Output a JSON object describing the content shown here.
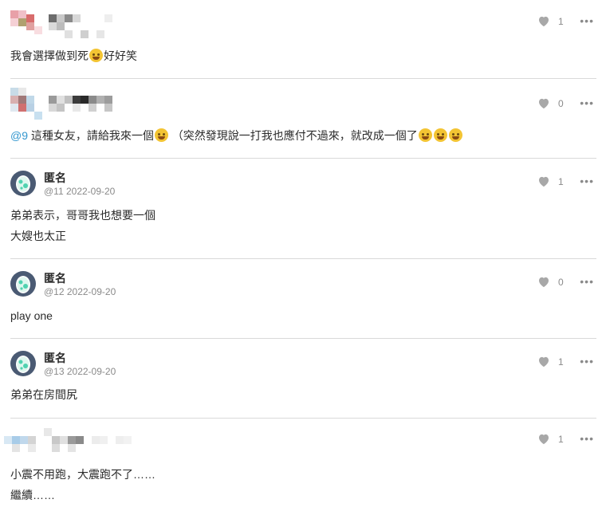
{
  "comments": [
    {
      "id": "c1",
      "author": "",
      "meta": "",
      "likes": "1",
      "lines": [
        "我會選擇做到死",
        "好好笑"
      ]
    },
    {
      "id": "c2",
      "author": "",
      "meta": "",
      "likes": "0",
      "mention": "@9",
      "lines": [
        "這種女友，請給我來一個",
        "（突然發現說一打我也應付不過來，就改成一個了"
      ]
    },
    {
      "id": "c3",
      "author": "匿名",
      "meta": "@11 2022-09-20",
      "likes": "1",
      "lines": [
        "弟弟表示，哥哥我也想要一個",
        "大嫂也太正"
      ]
    },
    {
      "id": "c4",
      "author": "匿名",
      "meta": "@12 2022-09-20",
      "likes": "0",
      "lines": [
        "play one"
      ]
    },
    {
      "id": "c5",
      "author": "匿名",
      "meta": "@13 2022-09-20",
      "likes": "1",
      "lines": [
        "弟弟在房間尻"
      ]
    },
    {
      "id": "c6",
      "author": "",
      "meta": "",
      "likes": "1",
      "lines": [
        "小震不用跑，大震跑不了……",
        "繼續……"
      ]
    }
  ],
  "icons": {
    "like": "heart-icon",
    "more": "more-options-icon",
    "avatar": "egg-avatar-icon",
    "emoji_laugh": "rofl-emoji",
    "emoji_grin": "grin-emoji"
  },
  "colors": {
    "mention": "#3397cf",
    "heart": "#a8a8a8",
    "divider": "#d9d9d9",
    "avatar_bg": "#4a5a73",
    "avatar_egg": "#4fd2b0"
  },
  "ui": {
    "more_label": "•••"
  }
}
